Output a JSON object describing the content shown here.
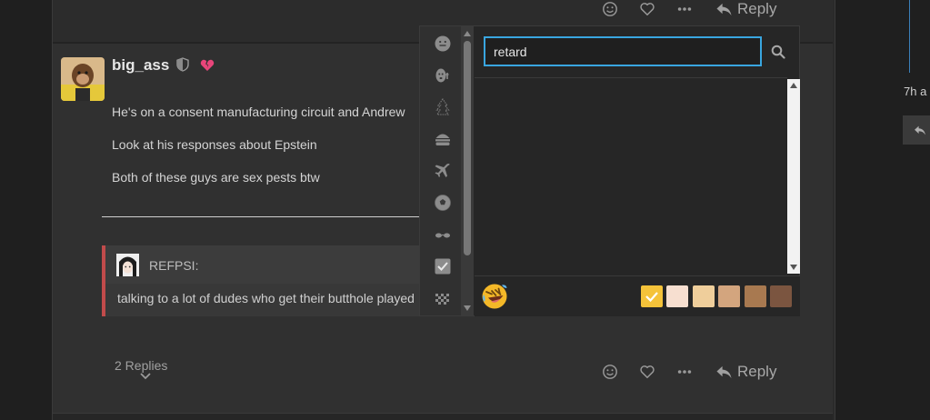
{
  "top": {
    "reply_label": "Reply"
  },
  "post": {
    "username": "big_ass",
    "lines": [
      "He's on a consent manufacturing circuit and Andrew",
      "Look at his responses about Epstein",
      "Both of these guys are sex pests btw"
    ],
    "quote": {
      "user": "REFPSI:",
      "text": "talking to a lot of dudes who get their butthole played"
    },
    "replies_label": "2 Replies",
    "reply_label": "Reply"
  },
  "right": {
    "time_text": "7h a"
  },
  "picker": {
    "search_value": "retard",
    "categories": [
      "smiley-face-icon",
      "people-icon",
      "tree-icon",
      "burger-icon",
      "airplane-icon",
      "soccer-ball-icon",
      "glasses-icon",
      "checkbox-icon",
      "checkered-flag-icon"
    ],
    "skin_tones": [
      "#f5c33a",
      "#f7dfd0",
      "#efce9b",
      "#d3a57e",
      "#a87950",
      "#7b5540"
    ],
    "selected_tone_index": 0
  },
  "colors": {
    "accent": "#39a6e0",
    "quote_border": "#c14b4b",
    "heart_badge": "#e8457a"
  }
}
